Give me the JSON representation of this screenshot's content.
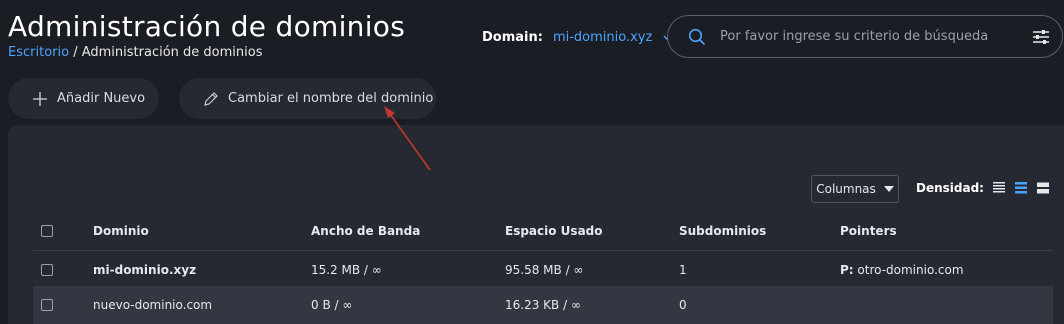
{
  "header": {
    "title": "Administración de dominios",
    "breadcrumb": {
      "link": "Escritorio",
      "separator": " / ",
      "current": "Administración de dominios"
    },
    "domain_label": "Domain:",
    "domain_value": "mi-dominio.xyz"
  },
  "search": {
    "placeholder": "Por favor ingrese su criterio de búsqueda",
    "value": ""
  },
  "actions": {
    "add_label": "Añadir Nuevo",
    "rename_label": "Cambiar el nombre del dominio"
  },
  "toolbar": {
    "columns_label": "Columnas",
    "density_label": "Densidad:",
    "density_selected": "medium"
  },
  "table": {
    "columns": [
      "Dominio",
      "Ancho de Banda",
      "Espacio Usado",
      "Subdominios",
      "Pointers"
    ],
    "rows": [
      {
        "dominio": "mi-dominio.xyz",
        "ancho": "15.2 MB / ∞",
        "espacio": "95.58 MB / ∞",
        "sub": "1",
        "pointers_prefix": "P:",
        "pointers": " otro-dominio.com"
      },
      {
        "dominio": "nuevo-dominio.com",
        "ancho": "0 B / ∞",
        "espacio": "16.23 KB / ∞",
        "sub": "0",
        "pointers_prefix": "",
        "pointers": ""
      }
    ]
  },
  "colors": {
    "accent": "#4aa3ff",
    "background": "#1b1d24",
    "panel": "#262931",
    "annotation_arrow": "#c0392b"
  }
}
